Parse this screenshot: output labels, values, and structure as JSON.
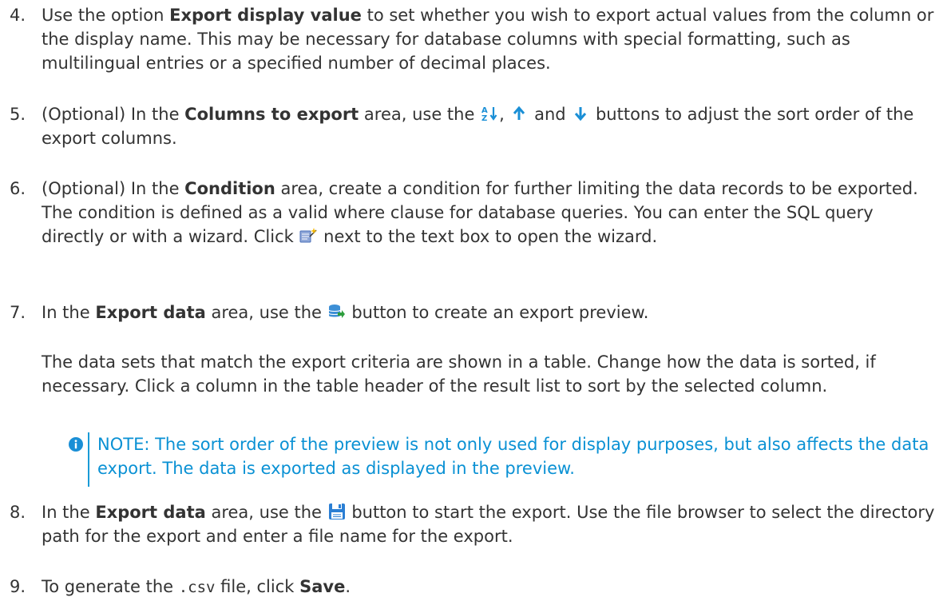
{
  "steps": [
    {
      "number": "4.",
      "t1": "Use the option ",
      "b1": "Export display value",
      "t2": " to set whether you wish to export actual values from the column or the display name. This may be necessary for database columns with special formatting, such as multilingual entries or a specified number of decimal places."
    },
    {
      "number": "5.",
      "t1": "(Optional) In the ",
      "b1": "Columns to export",
      "t2": " area, use the ",
      "t3": ", ",
      "t4": " and ",
      "t5": " buttons to adjust the sort order of the export columns.",
      "icon1": "sort-az-icon",
      "icon2": "arrow-up-icon",
      "icon3": "arrow-down-icon"
    },
    {
      "number": "6.",
      "t1": "(Optional) In the ",
      "b1": "Condition",
      "t2": " area, create a condition for further limiting the data records to be exported. The condition is defined as a valid where clause for database queries. You can enter the SQL query directly or with a wizard. Click ",
      "t3": " next to the text box to open the wizard.",
      "icon1": "wizard-icon"
    },
    {
      "number": "7.",
      "t1": "In the ",
      "b1": "Export data",
      "t2": " area, use the ",
      "t3": " button to create an export preview.",
      "icon1": "preview-icon",
      "para2": "The data sets that match the export criteria are shown in a table. Change how the data is sorted, if necessary. Click a column in the table header of the result list to sort by the selected column."
    },
    {
      "number": "8.",
      "t1": "In the ",
      "b1": "Export data",
      "t2": " area, use the ",
      "t3": " button to start the export. Use the file browser to select the directory path for the export and enter a file name for the export.",
      "icon1": "save-icon"
    },
    {
      "number": "9.",
      "t1": "To generate the ",
      "code1": ".csv",
      "t2": " file, click ",
      "b1": "Save",
      "t3": "."
    }
  ],
  "note": {
    "icon": "info-icon",
    "text": "NOTE: The sort order of the preview is not only used for display purposes, but also affects the data export. The data is exported as displayed in the preview."
  },
  "colors": {
    "text": "#333333",
    "note_text": "#0a91d4",
    "note_bar": "#1a9bd7",
    "icon_blue": "#1a8fd6"
  }
}
